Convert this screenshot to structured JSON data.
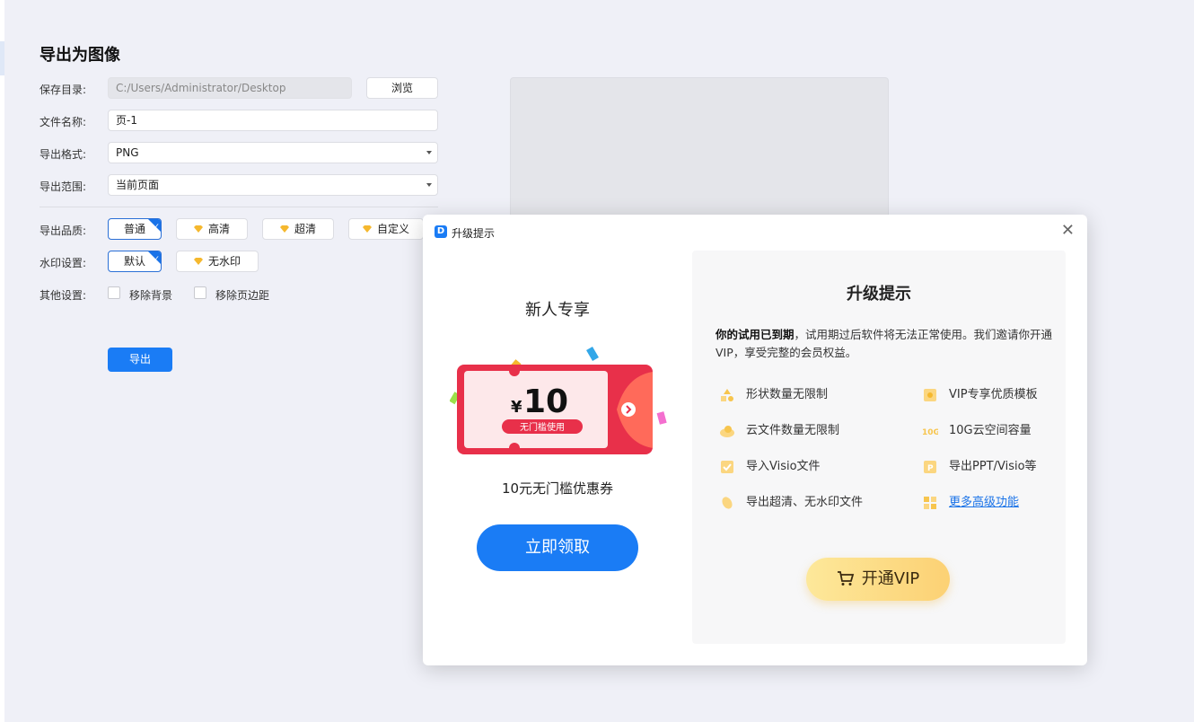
{
  "export": {
    "title": "导出为图像",
    "save_dir": {
      "label": "保存目录:",
      "value": "C:/Users/Administrator/Desktop",
      "browse": "浏览"
    },
    "file_name": {
      "label": "文件名称:",
      "value": "页-1"
    },
    "format": {
      "label": "导出格式:",
      "value": "PNG"
    },
    "range": {
      "label": "导出范围:",
      "value": "当前页面"
    },
    "quality": {
      "label": "导出品质:",
      "options": [
        "普通",
        "高清",
        "超清",
        "自定义"
      ],
      "selected": "普通"
    },
    "watermark": {
      "label": "水印设置:",
      "options": [
        "默认",
        "无水印"
      ],
      "selected": "默认"
    },
    "other": {
      "label": "其他设置:",
      "options": [
        "移除背景",
        "移除页边距"
      ]
    },
    "export_button": "导出"
  },
  "modal": {
    "title": "升级提示",
    "left": {
      "heading": "新人专享",
      "coupon_currency": "¥",
      "coupon_amount": "10",
      "coupon_tag": "无门槛使用",
      "coupon_desc": "10元无门槛优惠券",
      "claim_button": "立即领取"
    },
    "right": {
      "heading": "升级提示",
      "desc_bold": "你的试用已到期",
      "desc_rest": "，试用期过后软件将无法正常使用。我们邀请你开通VIP，享受完整的会员权益。",
      "features": [
        {
          "icon": "shapes-icon",
          "text": "形状数量无限制"
        },
        {
          "icon": "vip-template-icon",
          "text": "VIP专享优质模板"
        },
        {
          "icon": "cloud-icon",
          "text": "云文件数量无限制"
        },
        {
          "icon": "storage-10g-icon",
          "text": "10G云空间容量"
        },
        {
          "icon": "visio-import-icon",
          "text": "导入Visio文件"
        },
        {
          "icon": "ppt-export-icon",
          "text": "导出PPT/Visio等"
        },
        {
          "icon": "hd-export-icon",
          "text": "导出超清、无水印文件"
        },
        {
          "icon": "more-features-icon",
          "text": "更多高级功能"
        }
      ],
      "vip_button": "开通VIP"
    }
  },
  "colors": {
    "accent": "#1a7cf5",
    "gold": "#fcd174",
    "coupon_red": "#e8304a"
  }
}
